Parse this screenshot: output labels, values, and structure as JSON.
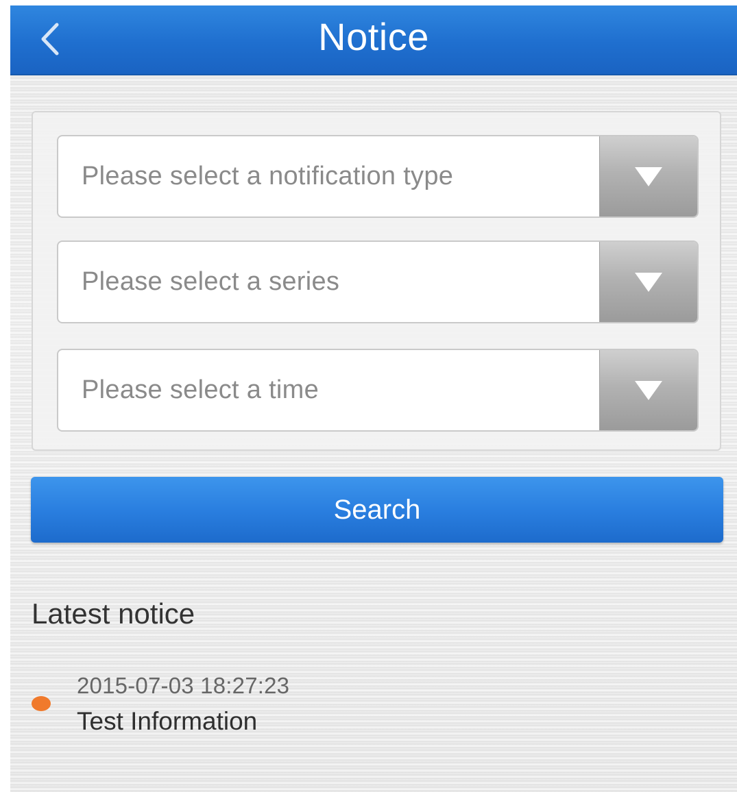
{
  "header": {
    "title": "Notice",
    "back_icon": "back-chevron-icon"
  },
  "filters": [
    {
      "placeholder": "Please select a notification type",
      "icon": "dropdown-arrow-icon"
    },
    {
      "placeholder": "Please select a series",
      "icon": "dropdown-arrow-icon"
    },
    {
      "placeholder": "Please select a time",
      "icon": "dropdown-arrow-icon"
    }
  ],
  "search_button": {
    "label": "Search"
  },
  "latest": {
    "title": "Latest notice",
    "items": [
      {
        "time": "2015-07-03 18:27:23",
        "text": "Test Information",
        "dot_color": "#f07a2c"
      }
    ]
  },
  "colors": {
    "header_blue": "#1f6fcf",
    "button_blue": "#2a7fe0",
    "unread_dot": "#f07a2c"
  }
}
